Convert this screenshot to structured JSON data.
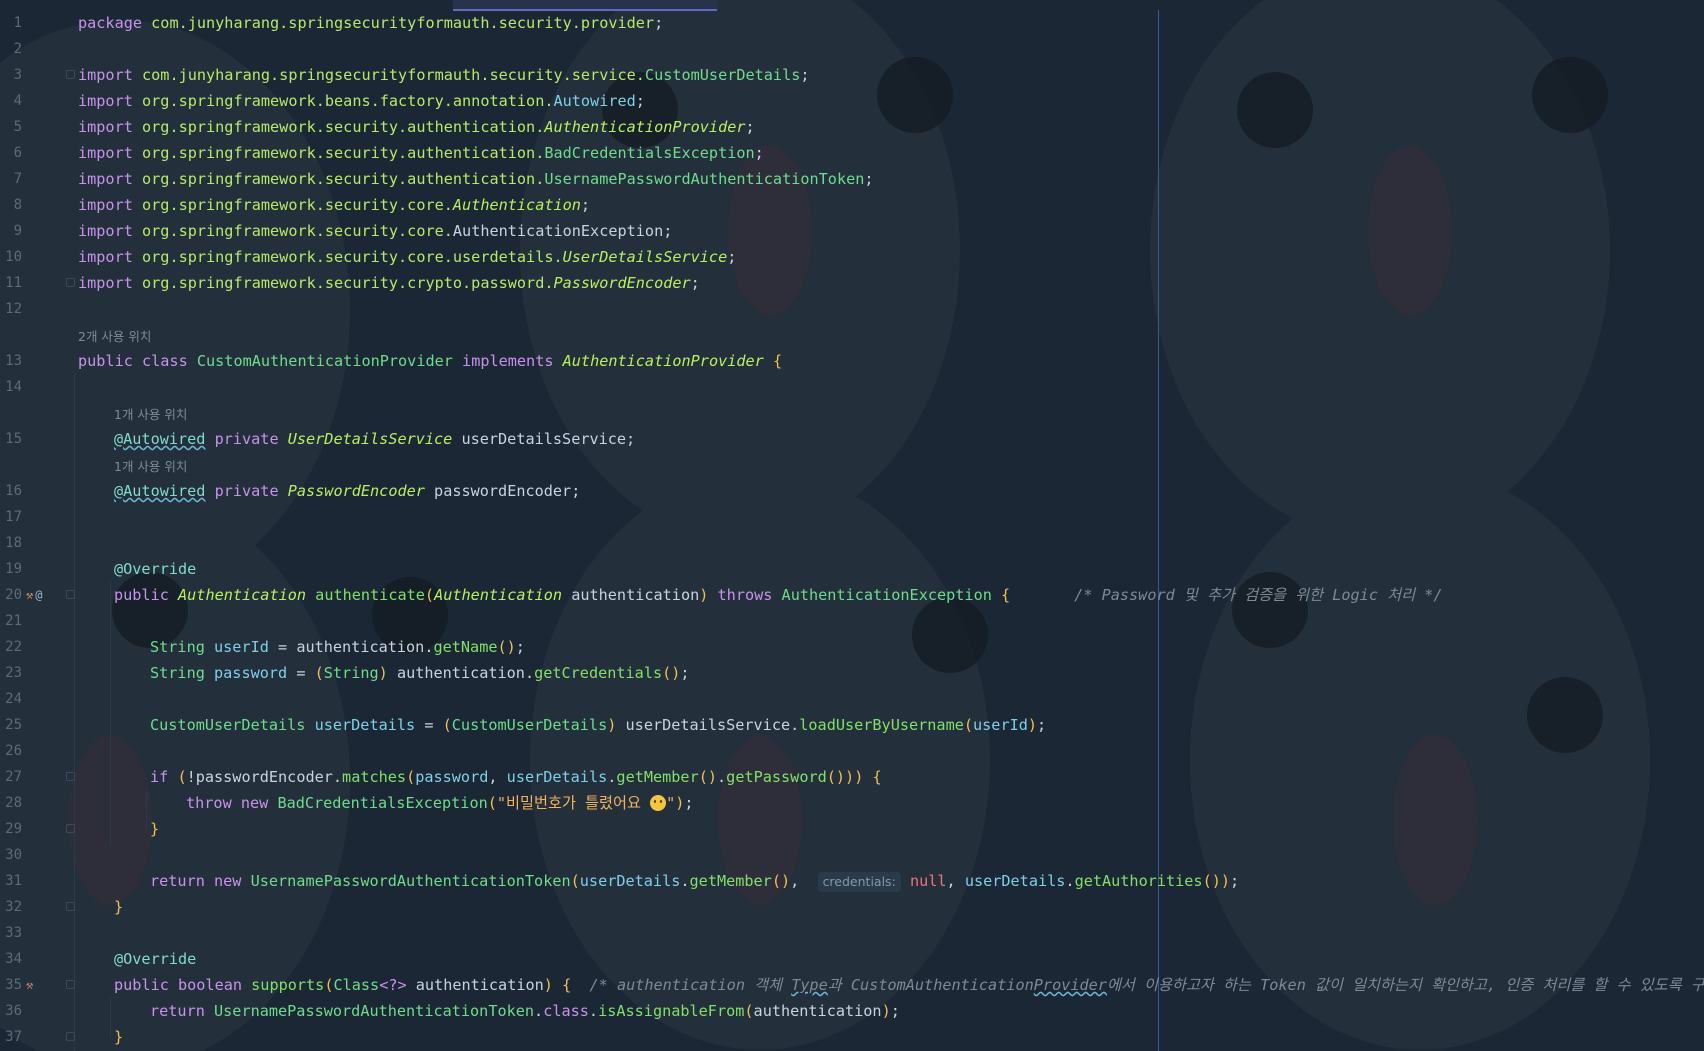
{
  "editor": {
    "lines": [
      {
        "n": "1",
        "tokens": [
          [
            "kw",
            "package "
          ],
          [
            "pk",
            "com.junyharang.springsecurityformauth.security.provider"
          ],
          [
            "pn",
            ";"
          ]
        ]
      },
      {
        "n": "2",
        "tokens": []
      },
      {
        "n": "3",
        "tokens": [
          [
            "kw",
            "import "
          ],
          [
            "pk",
            "com.junyharang.springsecurityformauth.security.service."
          ],
          [
            "ty",
            "CustomUserDetails"
          ],
          [
            "pn",
            ";"
          ]
        ]
      },
      {
        "n": "4",
        "tokens": [
          [
            "kw",
            "import "
          ],
          [
            "pk",
            "org.springframework.beans.factory.annotation."
          ],
          [
            "vr",
            "Autowired"
          ],
          [
            "pn",
            ";"
          ]
        ]
      },
      {
        "n": "5",
        "tokens": [
          [
            "kw",
            "import "
          ],
          [
            "pk",
            "org.springframework.security.authentication."
          ],
          [
            "it",
            "AuthenticationProvider"
          ],
          [
            "pn",
            ";"
          ]
        ]
      },
      {
        "n": "6",
        "tokens": [
          [
            "kw",
            "import "
          ],
          [
            "pk",
            "org.springframework.security.authentication."
          ],
          [
            "ty",
            "BadCredentialsException"
          ],
          [
            "pn",
            ";"
          ]
        ]
      },
      {
        "n": "7",
        "tokens": [
          [
            "kw",
            "import "
          ],
          [
            "pk",
            "org.springframework.security.authentication."
          ],
          [
            "ty",
            "UsernamePasswordAuthenticationToken"
          ],
          [
            "pn",
            ";"
          ]
        ]
      },
      {
        "n": "8",
        "tokens": [
          [
            "kw",
            "import "
          ],
          [
            "pk",
            "org.springframework.security.core."
          ],
          [
            "it",
            "Authentication"
          ],
          [
            "pn",
            ";"
          ]
        ]
      },
      {
        "n": "9",
        "tokens": [
          [
            "kw",
            "import "
          ],
          [
            "pk",
            "org.springframework.security.core."
          ],
          [
            "pn",
            "AuthenticationException"
          ],
          [
            "pn",
            ";"
          ]
        ]
      },
      {
        "n": "10",
        "tokens": [
          [
            "kw",
            "import "
          ],
          [
            "pk",
            "org.springframework.security.core.userdetails."
          ],
          [
            "it",
            "UserDetailsService"
          ],
          [
            "pn",
            ";"
          ]
        ]
      },
      {
        "n": "11",
        "tokens": [
          [
            "kw",
            "import "
          ],
          [
            "pk",
            "org.springframework.security.crypto.password."
          ],
          [
            "it",
            "PasswordEncoder"
          ],
          [
            "pn",
            ";"
          ]
        ]
      },
      {
        "n": "12",
        "tokens": []
      },
      {
        "hint": "2개 사용 위치",
        "indent": 0
      },
      {
        "n": "13",
        "tokens": [
          [
            "kw",
            "public class "
          ],
          [
            "ty",
            "CustomAuthenticationProvider "
          ],
          [
            "kw",
            "implements "
          ],
          [
            "it",
            "AuthenticationProvider "
          ],
          [
            "br",
            "{"
          ]
        ]
      },
      {
        "n": "14",
        "tokens": []
      },
      {
        "hint": "1개 사용 위치",
        "indent": 1
      },
      {
        "n": "15",
        "indent": 1,
        "tokens": [
          [
            "an squig",
            "@Autowired"
          ],
          [
            "kw",
            " private "
          ],
          [
            "it",
            "UserDetailsService "
          ],
          [
            "pn",
            "userDetailsService;"
          ]
        ]
      },
      {
        "hint": "1개 사용 위치",
        "indent": 1
      },
      {
        "n": "16",
        "indent": 1,
        "tokens": [
          [
            "an squig",
            "@Autowired"
          ],
          [
            "kw",
            " private "
          ],
          [
            "it",
            "PasswordEncoder "
          ],
          [
            "pn",
            "passwordEncoder;"
          ]
        ]
      },
      {
        "n": "17",
        "tokens": []
      },
      {
        "n": "18",
        "tokens": []
      },
      {
        "n": "19",
        "indent": 1,
        "tokens": [
          [
            "an",
            "@Override"
          ]
        ]
      },
      {
        "n": "20",
        "indent": 1,
        "gutter": "impl",
        "tokens": [
          [
            "kw",
            "public "
          ],
          [
            "it",
            "Authentication "
          ],
          [
            "fn",
            "authenticate"
          ],
          [
            "br",
            "("
          ],
          [
            "it",
            "Authentication "
          ],
          [
            "pn",
            "authentication"
          ],
          [
            "br",
            ") "
          ],
          [
            "kw",
            "throws "
          ],
          [
            "ty",
            "AuthenticationException "
          ],
          [
            "br",
            "{"
          ],
          [
            "pn",
            "       "
          ],
          [
            "cm",
            "/* Password 및 추가 검증을 위한 Logic 처리 */"
          ]
        ]
      },
      {
        "n": "21",
        "tokens": []
      },
      {
        "n": "22",
        "indent": 2,
        "tokens": [
          [
            "ty",
            "String "
          ],
          [
            "vr",
            "userId "
          ],
          [
            "pn",
            "= authentication."
          ],
          [
            "fn",
            "getName"
          ],
          [
            "br",
            "()"
          ],
          [
            "pn",
            ";"
          ]
        ]
      },
      {
        "n": "23",
        "indent": 2,
        "tokens": [
          [
            "ty",
            "String "
          ],
          [
            "vr",
            "password "
          ],
          [
            "pn",
            "= "
          ],
          [
            "br",
            "("
          ],
          [
            "ty",
            "String"
          ],
          [
            "br",
            ") "
          ],
          [
            "pn",
            "authentication."
          ],
          [
            "fn",
            "getCredentials"
          ],
          [
            "br",
            "()"
          ],
          [
            "pn",
            ";"
          ]
        ]
      },
      {
        "n": "24",
        "tokens": []
      },
      {
        "n": "25",
        "indent": 2,
        "tokens": [
          [
            "ty",
            "CustomUserDetails "
          ],
          [
            "vr",
            "userDetails "
          ],
          [
            "pn",
            "= "
          ],
          [
            "br",
            "("
          ],
          [
            "ty",
            "CustomUserDetails"
          ],
          [
            "br",
            ") "
          ],
          [
            "pn",
            "userDetailsService."
          ],
          [
            "fn",
            "loadUserByUsername"
          ],
          [
            "br",
            "("
          ],
          [
            "vr",
            "userId"
          ],
          [
            "br",
            ")"
          ],
          [
            "pn",
            ";"
          ]
        ]
      },
      {
        "n": "26",
        "tokens": []
      },
      {
        "n": "27",
        "indent": 2,
        "tokens": [
          [
            "kw",
            "if "
          ],
          [
            "br",
            "("
          ],
          [
            "pn",
            "!passwordEncoder."
          ],
          [
            "fn",
            "matches"
          ],
          [
            "br",
            "("
          ],
          [
            "vr",
            "password"
          ],
          [
            "pn",
            ", "
          ],
          [
            "vr",
            "userDetails"
          ],
          [
            "pn",
            "."
          ],
          [
            "fn",
            "getMember"
          ],
          [
            "br",
            "()"
          ],
          [
            "pn",
            "."
          ],
          [
            "fn",
            "getPassword"
          ],
          [
            "br",
            "())) {"
          ]
        ]
      },
      {
        "n": "28",
        "indent": 3,
        "tokens": [
          [
            "kw",
            "throw new "
          ],
          [
            "ty",
            "BadCredentialsException"
          ],
          [
            "br",
            "("
          ],
          [
            "st",
            "\"비밀번호가 틀렸어요 "
          ],
          [
            "emoji",
            ""
          ],
          [
            "st",
            "\""
          ],
          [
            "br",
            ")"
          ],
          [
            "pn",
            ";"
          ]
        ]
      },
      {
        "n": "29",
        "indent": 2,
        "tokens": [
          [
            "br",
            "}"
          ]
        ]
      },
      {
        "n": "30",
        "tokens": []
      },
      {
        "n": "31",
        "indent": 2,
        "tokens": [
          [
            "kw",
            "return new "
          ],
          [
            "ty",
            "UsernamePasswordAuthenticationToken"
          ],
          [
            "br",
            "("
          ],
          [
            "vr",
            "userDetails"
          ],
          [
            "pn",
            "."
          ],
          [
            "fn",
            "getMember"
          ],
          [
            "br",
            "()"
          ],
          [
            "pn",
            ",  "
          ],
          [
            "inlay",
            "credentials:"
          ],
          [
            "pn",
            " "
          ],
          [
            "nu",
            "null"
          ],
          [
            "pn",
            ", "
          ],
          [
            "vr",
            "userDetails"
          ],
          [
            "pn",
            "."
          ],
          [
            "fn",
            "getAuthorities"
          ],
          [
            "br",
            "())"
          ],
          [
            "pn",
            ";"
          ]
        ]
      },
      {
        "n": "32",
        "indent": 1,
        "tokens": [
          [
            "br",
            "}"
          ]
        ]
      },
      {
        "n": "33",
        "tokens": []
      },
      {
        "n": "34",
        "indent": 1,
        "tokens": [
          [
            "an",
            "@Override"
          ]
        ]
      },
      {
        "n": "35",
        "indent": 1,
        "gutter": "impl-only",
        "tokens": [
          [
            "kw",
            "public boolean "
          ],
          [
            "fn",
            "supports"
          ],
          [
            "br",
            "("
          ],
          [
            "ty",
            "Class"
          ],
          [
            "kw",
            "<?> "
          ],
          [
            "pn",
            "authentication"
          ],
          [
            "br",
            ") {"
          ],
          [
            "pn",
            "  "
          ],
          [
            "cm",
            "/* authentication 객체 "
          ],
          [
            "cm squig",
            "Type"
          ],
          [
            "cm",
            "과 CustomAuthentication"
          ],
          [
            "cm squig",
            "Provider"
          ],
          [
            "cm",
            "에서 이용하고자 하는 Token 값이 일치하는지 확인하고, 인증 처리를 할 수 있도록 구현 */"
          ]
        ]
      },
      {
        "n": "36",
        "indent": 2,
        "tokens": [
          [
            "kw",
            "return "
          ],
          [
            "ty",
            "UsernamePasswordAuthenticationToken"
          ],
          [
            "pn",
            "."
          ],
          [
            "kw",
            "class"
          ],
          [
            "pn",
            "."
          ],
          [
            "fn",
            "isAssignableFrom"
          ],
          [
            "br",
            "("
          ],
          [
            "pn",
            "authentication"
          ],
          [
            "br",
            ")"
          ],
          [
            "pn",
            ";"
          ]
        ]
      },
      {
        "n": "37",
        "indent": 1,
        "tokens": [
          [
            "br",
            "}"
          ]
        ]
      }
    ],
    "gutter_icons": {
      "impl": "implementation-icon",
      "override": "at-override-icon"
    },
    "colors": {
      "background": "#1b2734",
      "keyword": "#c792ea",
      "type": "#6fdc8c",
      "string": "#f2b35c",
      "comment": "#7d8a96"
    }
  }
}
